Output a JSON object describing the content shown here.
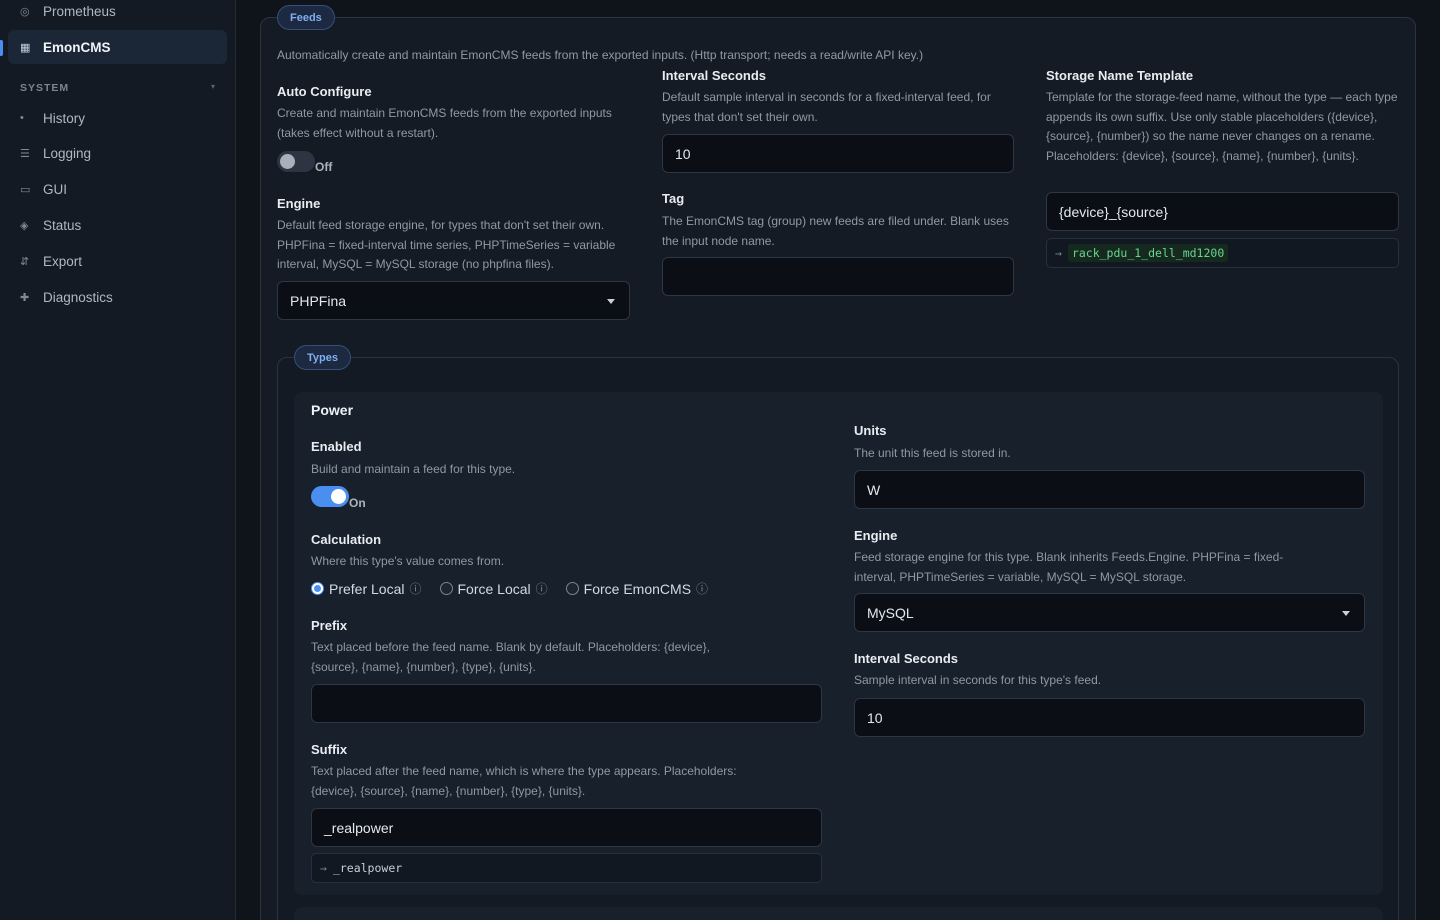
{
  "sidebar": {
    "items": [
      {
        "label": "Prometheus",
        "icon": "target-icon",
        "glyph": "◎"
      },
      {
        "label": "EmonCMS",
        "icon": "grid-icon",
        "glyph": "▦"
      }
    ],
    "section_label": "SYSTEM",
    "section_chevron": "▾",
    "system_items": [
      {
        "label": "History",
        "icon": "dot-icon",
        "glyph": "•"
      },
      {
        "label": "Logging",
        "icon": "list-icon",
        "glyph": "☰"
      },
      {
        "label": "GUI",
        "icon": "window-icon",
        "glyph": "▭"
      },
      {
        "label": "Status",
        "icon": "diamond-icon",
        "glyph": "◈"
      },
      {
        "label": "Export",
        "icon": "export-icon",
        "glyph": "⇵"
      },
      {
        "label": "Diagnostics",
        "icon": "plus-icon",
        "glyph": "✚"
      }
    ]
  },
  "feeds": {
    "pill": "Feeds",
    "intro": "Automatically create and maintain EmonCMS feeds from the exported inputs. (Http transport; needs a read/write API key.)",
    "auto_configure": {
      "label": "Auto Configure",
      "desc": "Create and maintain EmonCMS feeds from the exported inputs (takes effect without a restart).",
      "state": "Off"
    },
    "engine": {
      "label": "Engine",
      "desc": "Default feed storage engine, for types that don't set their own. PHPFina = fixed-interval time series, PHPTimeSeries = variable interval, MySQL = MySQL storage (no phpfina files).",
      "value": "PHPFina"
    },
    "interval": {
      "label": "Interval Seconds",
      "desc": "Default sample interval in seconds for a fixed-interval feed, for types that don't set their own.",
      "value": "10"
    },
    "tag": {
      "label": "Tag",
      "desc": "The EmonCMS tag (group) new feeds are filed under. Blank uses the input node name.",
      "value": ""
    },
    "storage_template": {
      "label": "Storage Name Template",
      "desc": "Template for the storage-feed name, without the type — each type appends its own suffix. Use only stable placeholders ({device}, {source}, {number}) so the name never changes on a rename. Placeholders: {device}, {source}, {name}, {number}, {units}.",
      "value": "{device}_{source}",
      "preview_arrow": "→",
      "preview": "rack_pdu_1_dell_md1200"
    }
  },
  "types": {
    "pill": "Types",
    "power": {
      "title": "Power",
      "enabled": {
        "label": "Enabled",
        "desc": "Build and maintain a feed for this type.",
        "state": "On"
      },
      "calculation": {
        "label": "Calculation",
        "desc": "Where this type's value comes from.",
        "options": [
          "Prefer Local",
          "Force Local",
          "Force EmonCMS"
        ],
        "selected": "Prefer Local",
        "info_glyph": "ⓘ"
      },
      "prefix": {
        "label": "Prefix",
        "desc": "Text placed before the feed name. Blank by default. Placeholders: {device}, {source}, {name}, {number}, {type}, {units}.",
        "value": ""
      },
      "suffix": {
        "label": "Suffix",
        "desc": "Text placed after the feed name, which is where the type appears. Placeholders: {device}, {source}, {name}, {number}, {type}, {units}.",
        "value": "_realpower",
        "preview_arrow": "→",
        "preview": "_realpower"
      },
      "units": {
        "label": "Units",
        "desc": "The unit this feed is stored in.",
        "value": "W"
      },
      "engine": {
        "label": "Engine",
        "desc": "Feed storage engine for this type. Blank inherits Feeds.Engine. PHPFina = fixed-interval, PHPTimeSeries = variable, MySQL = MySQL storage.",
        "value": "MySQL"
      },
      "interval": {
        "label": "Interval Seconds",
        "desc": "Sample interval in seconds for this type's feed.",
        "value": "10"
      }
    }
  },
  "colors": {
    "accent": "#4a8ff0",
    "background": "#0f141b",
    "preview_green": "#69d48e"
  }
}
